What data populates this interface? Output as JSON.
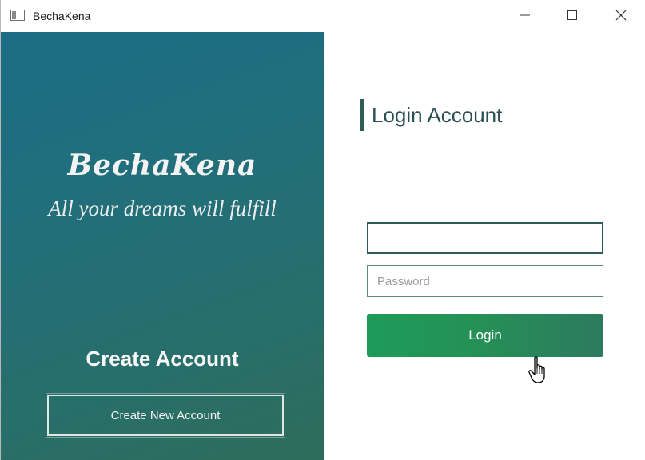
{
  "window": {
    "title": "BechaKena",
    "icon": "app-window-icon",
    "controls": {
      "minimize_icon": "minimize-icon",
      "maximize_icon": "maximize-icon",
      "close_icon": "close-icon"
    }
  },
  "left_panel": {
    "brand_name": "BechaKena",
    "tagline": "All your dreams will fulfill",
    "create_heading": "Create Account",
    "create_button_label": "Create New Account",
    "gradient_colors": [
      "#1b6e86",
      "#2d6d5b"
    ]
  },
  "login": {
    "heading": "Login Account",
    "username_value": "",
    "username_placeholder": "",
    "password_placeholder": "Password",
    "login_button_label": "Login",
    "button_color": "#1e9b58"
  },
  "pointer": "hand-cursor-icon"
}
